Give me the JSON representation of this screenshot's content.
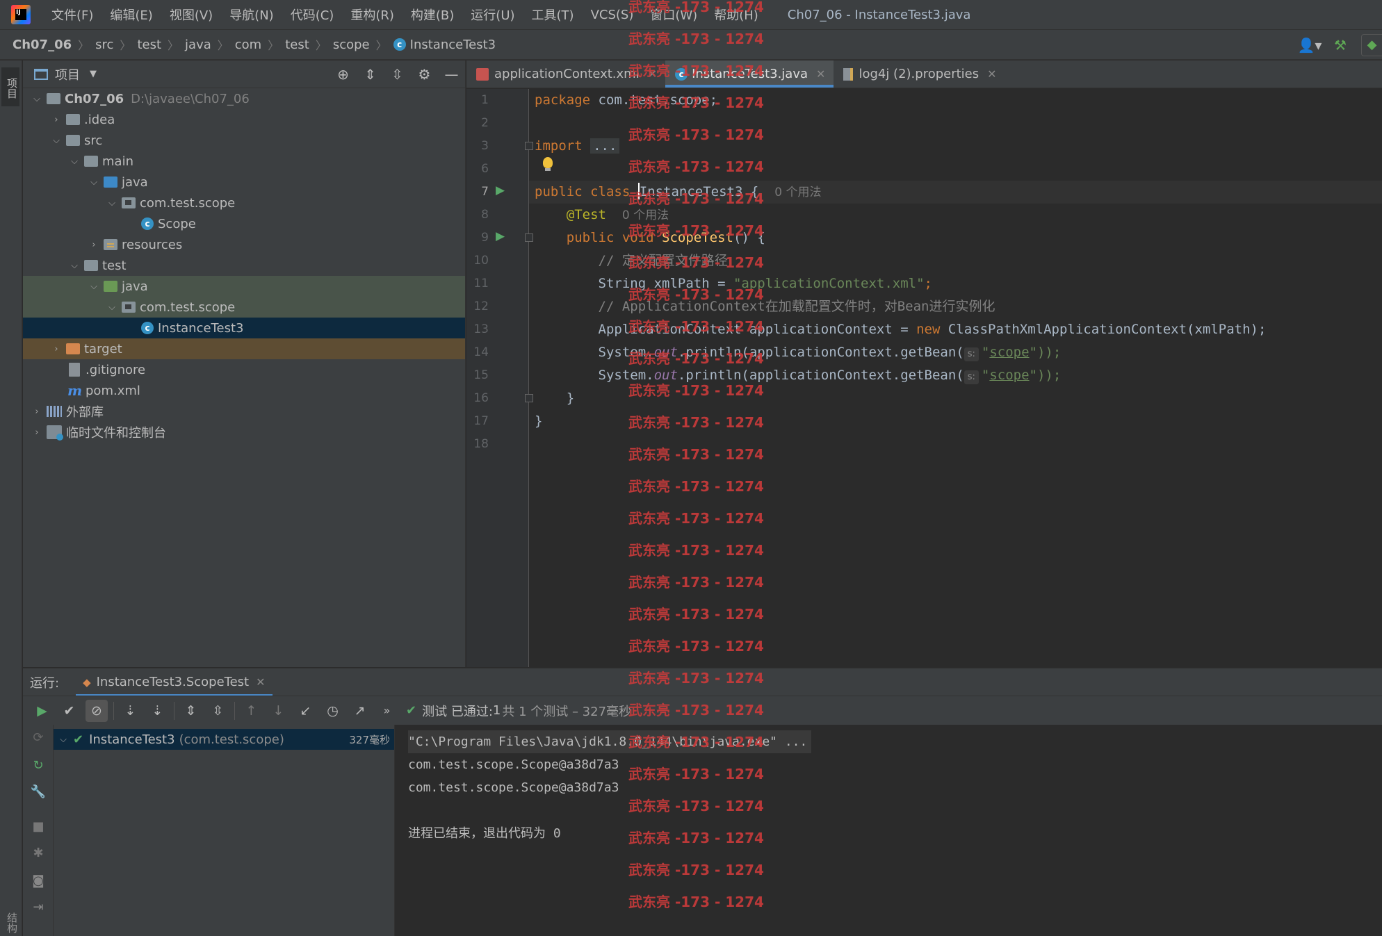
{
  "menu": {
    "items": [
      "文件(F)",
      "编辑(E)",
      "视图(V)",
      "导航(N)",
      "代码(C)",
      "重构(R)",
      "构建(B)",
      "运行(U)",
      "工具(T)",
      "VCS(S)",
      "窗口(W)",
      "帮助(H)"
    ],
    "window_title": "Ch07_06 - InstanceTest3.java"
  },
  "breadcrumb": [
    "Ch07_06",
    "src",
    "test",
    "java",
    "com",
    "test",
    "scope",
    "InstanceTest3"
  ],
  "sidebar_tabs": {
    "project": "项目",
    "structure": "结构"
  },
  "project_panel": {
    "title": "项目",
    "tree": [
      {
        "label": "Ch07_06",
        "path": "D:\\javaee\\Ch07_06"
      },
      {
        "label": ".idea"
      },
      {
        "label": "src"
      },
      {
        "label": "main"
      },
      {
        "label": "java"
      },
      {
        "label": "com.test.scope"
      },
      {
        "label": "Scope"
      },
      {
        "label": "resources"
      },
      {
        "label": "test"
      },
      {
        "label": "java"
      },
      {
        "label": "com.test.scope"
      },
      {
        "label": "InstanceTest3"
      },
      {
        "label": "target"
      },
      {
        "label": ".gitignore"
      },
      {
        "label": "pom.xml"
      },
      {
        "label": "外部库"
      },
      {
        "label": "临时文件和控制台"
      }
    ]
  },
  "editor_tabs": [
    {
      "label": "applicationContext.xml",
      "active": false
    },
    {
      "label": "InstanceTest3.java",
      "active": true
    },
    {
      "label": "log4j (2).properties",
      "active": false
    }
  ],
  "code": {
    "line_numbers": [
      "1",
      "2",
      "3",
      "6",
      "7",
      "8",
      "9",
      "10",
      "11",
      "12",
      "13",
      "14",
      "15",
      "16",
      "17",
      "18"
    ],
    "package_kw": "package",
    "package_name": " com.test.scope;",
    "import_kw": "import",
    "import_fold": "...",
    "public_class": "public class ",
    "class_name": "InstanceTest3",
    "class_open": " {",
    "usage_hint": "0 个用法",
    "annotation": "@Test",
    "public_void": "public void ",
    "method_name": "ScopeTest",
    "method_sig": "() {",
    "comment1": "// 定义配置文件路径",
    "str_decl": "String xmlPath = ",
    "xml_path": "\"applicationContext.xml\"",
    "semicolon": ";",
    "comment2": "// ApplicationContext在加载配置文件时，对Bean进行实例化",
    "ctx_decl": "ApplicationContext applicationContext = ",
    "new_kw": "new",
    "ctx_ctor": " ClassPathXmlApplicationContext(xmlPath);",
    "sys": "System.",
    "out": "out",
    "println": ".println(applicationContext.getBean(",
    "param_hint": "s:",
    "q_open": "\"",
    "scope_str": "scope",
    "close_call": "\"));",
    "close_brace": "}"
  },
  "run_panel": {
    "label": "运行:",
    "tab": "InstanceTest3.ScopeTest",
    "status_prefix": "测试 已通过: ",
    "status_count": "1",
    "status_detail": "共 1 个测试 – 327毫秒",
    "test_class": "InstanceTest3",
    "test_pkg": "(com.test.scope)",
    "test_time": "327毫秒"
  },
  "console": {
    "lines": [
      "\"C:\\Program Files\\Java\\jdk1.8.0_144\\bin\\java.exe\" ...",
      "com.test.scope.Scope@a38d7a3",
      "com.test.scope.Scope@a38d7a3",
      "",
      "进程已结束，退出代码为 0"
    ]
  },
  "watermark": "武东亮 -173 - 1274",
  "colors": {
    "keyword": "#cc7832",
    "string": "#6a8759",
    "comment": "#808080",
    "annotation": "#bbb529",
    "method": "#ffc66d",
    "watermark": "#c83b3b",
    "accent": "#4a88c7",
    "pass": "#59a869"
  }
}
